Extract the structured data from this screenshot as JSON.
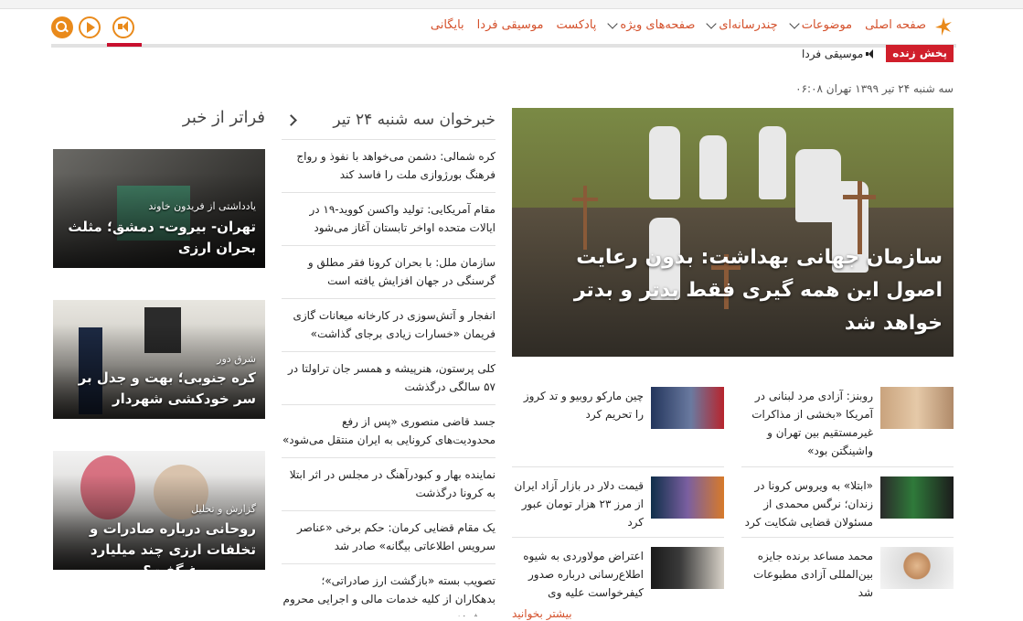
{
  "nav": {
    "items": [
      {
        "label": "صفحه اصلی",
        "dropdown": false
      },
      {
        "label": "موضوعات",
        "dropdown": true
      },
      {
        "label": "چندرسانه‌ای",
        "dropdown": true
      },
      {
        "label": "صفحه‌های ویژه",
        "dropdown": true
      },
      {
        "label": "پادکست",
        "dropdown": false
      },
      {
        "label": "موسیقی فردا",
        "dropdown": false
      },
      {
        "label": "بایگانی",
        "dropdown": false
      }
    ],
    "accent": "#e98a1b",
    "live_color": "#d01f2b"
  },
  "live": {
    "badge": "پخش زنده",
    "item": "موسیقی فردا"
  },
  "dateline": "سه شنبه ۲۴ تیر ۱۳۹۹ تهران ۰۶:۰۸",
  "hero": {
    "title": "سازمان جهانی بهداشت: بدون رعایت اصول این همه گیری فقط بدتر و بدتر خواهد شد"
  },
  "headlines": {
    "title": "خبرخوان سه شنبه ۲۴ تیر",
    "items": [
      "کره شمالی: دشمن می‌خواهد با نفوذ و رواج فرهنگ بورژوازی ملت را فاسد کند",
      "مقام آمریکایی: تولید واکسن کووید-۱۹ در ایالات متحده اواخر تابستان آغاز می‌شود",
      "سازمان ملل: با بحران کرونا فقر مطلق و گرسنگی در جهان افزایش یافته است",
      "انفجار و آتش‌سوزی در کارخانه میعانات گازی فریمان «خسارات زیادی برجای گذاشت»",
      "کلی پرستون، هنرپیشه و همسر جان تراولتا در ۵۷ سالگی درگذشت",
      "جسد قاضی منصوری «پس از رفع محدودیت‌های کرونایی به ایران منتقل می‌شود»",
      "نماینده بهار و کبودرآهنگ در مجلس در اثر ابتلا به کرونا درگذشت",
      "یک مقام قضایی کرمان: حکم برخی «عناصر سرویس اطلاعاتی بیگانه» صادر شد",
      "تصویب بسته «بازگشت ارز صادراتی»؛ بدهکاران از کلیه خدمات مالی و اجرایی محروم می‌شوند"
    ]
  },
  "beyond": {
    "title": "فراتر از خبر",
    "cards": [
      {
        "kicker": "یادداشتی از فریدون خاوند",
        "title": "تهران- بیروت- دمشق؛ مثلث بحران ارزی"
      },
      {
        "kicker": "شرق دور",
        "title": "کره جنوبی؛ بهت و جدل بر سر خودکشی شهردار محبوب"
      },
      {
        "kicker": "گزارش و تحلیل",
        "title": "روحانی درباره صادرات و تخلفات ارزی چند میلیارد یورو دروغ گفت؟"
      }
    ]
  },
  "stories": [
    {
      "text": "روبنز: آزادی مرد لبنانی در آمریکا «بخشی از مذاکرات غیرمستقیم بین تهران و واشینگتن بود»"
    },
    {
      "text": "چین مارکو روبیو و تد کروز را تحریم کرد"
    },
    {
      "text": "«ابتلا» به ویروس کرونا در زندان؛ نرگس محمدی از مسئولان قضایی شکایت کرد"
    },
    {
      "text": "قیمت دلار در بازار آزاد ایران از مرز ۲۳ هزار تومان عبور کرد"
    },
    {
      "text": "محمد مساعد برنده جایزه بین‌المللی آزادی مطبوعات شد"
    },
    {
      "text": "اعتراض مولاوردی به شیوه اطلاع‌رسانی درباره صدور کیفرخواست علیه وی"
    }
  ],
  "more_link": "بیشتر بخوانید"
}
